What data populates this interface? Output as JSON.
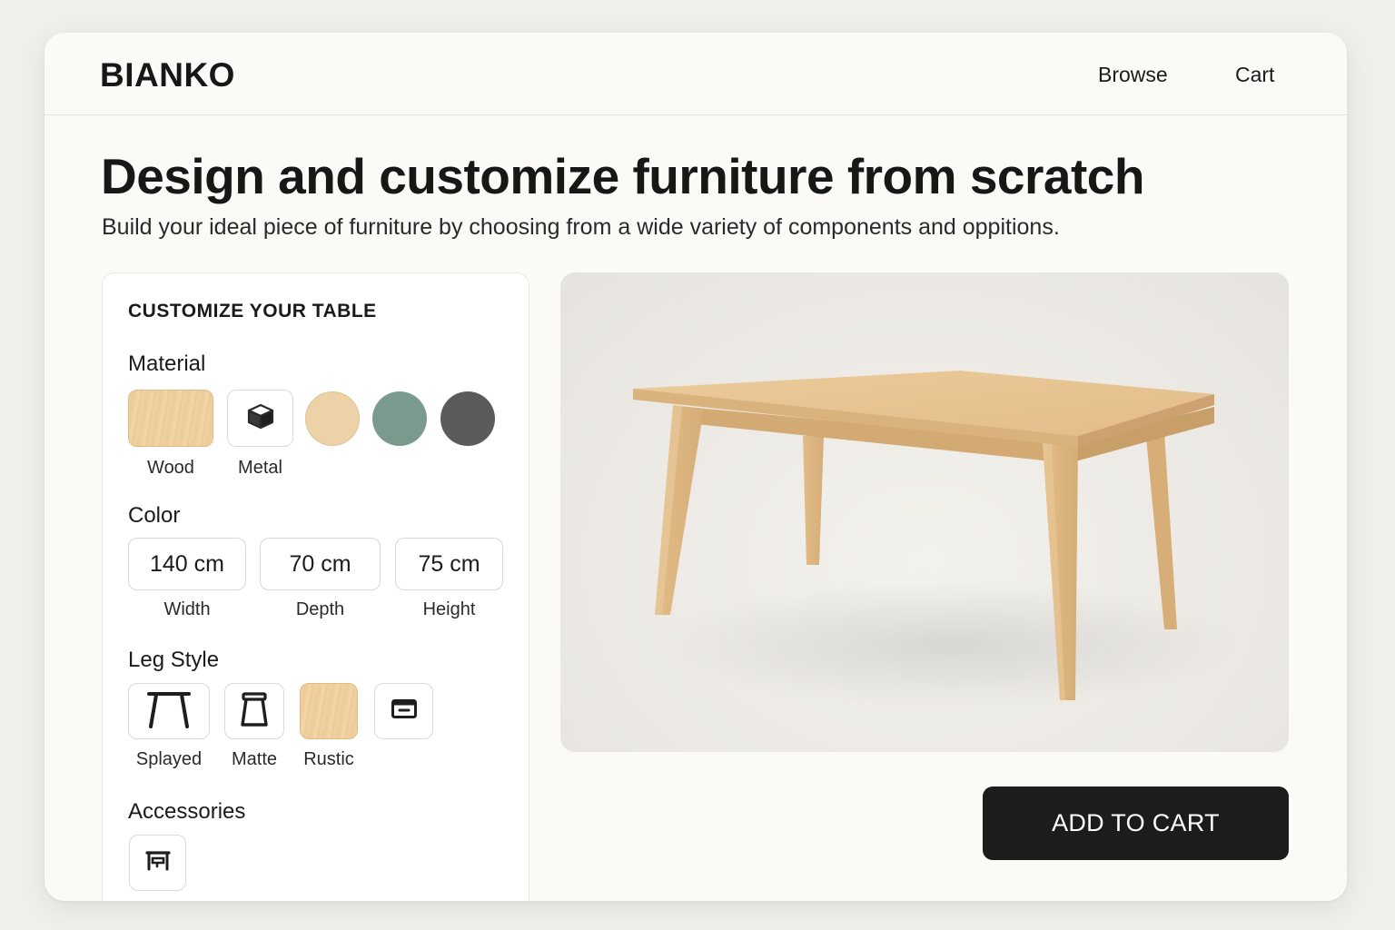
{
  "brand": "BIANKO",
  "nav": {
    "browse": "Browse",
    "cart": "Cart"
  },
  "hero": {
    "title": "Design and customize furniture from scratch",
    "subtitle": "Build your ideal piece of furniture by choosing from a wide variety of components and oppitions."
  },
  "panel": {
    "title": "CUSTOMIZE YOUR TABLE",
    "material": {
      "label": "Material",
      "options": [
        {
          "name": "Wood",
          "icon": "wood-texture-icon",
          "selected": true
        },
        {
          "name": "Metal",
          "icon": "metal-cube-icon"
        },
        {
          "name": "",
          "color": "#ecd2a6"
        },
        {
          "name": "",
          "color": "#7a9a8d"
        },
        {
          "name": "",
          "color": "#5b5b5b"
        }
      ]
    },
    "color": {
      "label": "Color",
      "dimensions": [
        {
          "value": "140 cm",
          "label": "Width"
        },
        {
          "value": "70 cm",
          "label": "Depth"
        },
        {
          "value": "75 cm",
          "label": "Height"
        }
      ]
    },
    "leg_style": {
      "label": "Leg Style",
      "options": [
        {
          "name": "Splayed",
          "icon": "splayed-leg-icon"
        },
        {
          "name": "Matte",
          "icon": "matte-leg-icon"
        },
        {
          "name": "Rustic",
          "icon": "wood-texture-icon",
          "selected": true
        },
        {
          "name": "",
          "icon": "drawer-box-icon"
        }
      ]
    },
    "accessories": {
      "label": "Accessories",
      "options": [
        {
          "name": "",
          "icon": "drawer-accessory-icon"
        }
      ]
    }
  },
  "cta": {
    "add_to_cart": "ADD TO CART"
  },
  "colors": {
    "accent_dark": "#1c1c1c",
    "wood": "#e2c091",
    "background": "#fbfaf6"
  }
}
